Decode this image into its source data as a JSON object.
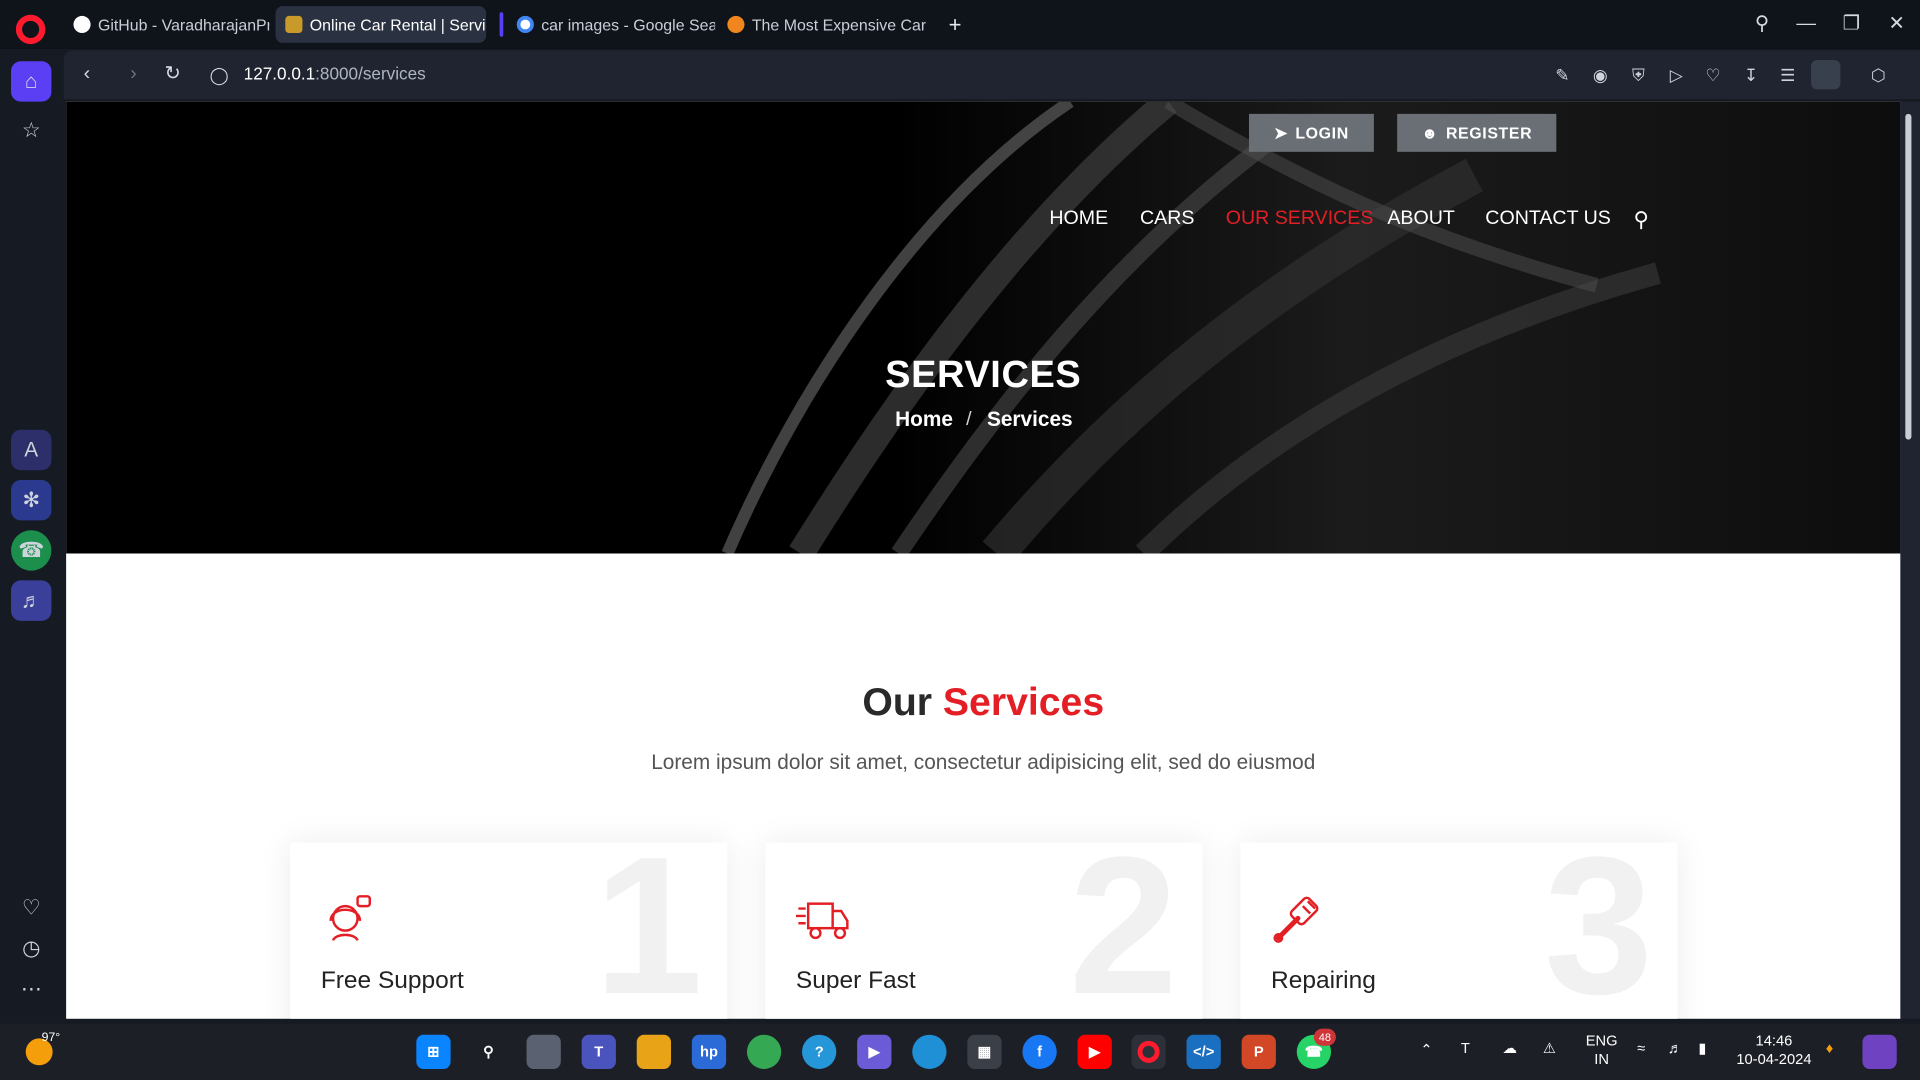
{
  "browser": {
    "tabs": [
      {
        "title": "GitHub - VaradharajanProj"
      },
      {
        "title": "Online Car Rental | Service"
      },
      {
        "title": "car images - Google Searc"
      },
      {
        "title": "The Most Expensive Car In"
      }
    ],
    "url_host": "127.0.0.1",
    "url_path": ":8000/services"
  },
  "site": {
    "login_label": "LOGIN",
    "register_label": "REGISTER",
    "nav": [
      "HOME",
      "CARS",
      "OUR SERVICES",
      "ABOUT",
      "CONTACT US"
    ],
    "active_nav": "OUR SERVICES",
    "hero_title": "SERVICES",
    "breadcrumb": {
      "home": "Home",
      "separator": "/",
      "current": "Services"
    },
    "section_title_dark": "Our",
    "section_title_red": "Services",
    "section_subtitle": "Lorem ipsum dolor sit amet, consectetur adipisicing elit, sed do eiusmod",
    "cards": [
      {
        "number": "1",
        "title": "Free Support",
        "icon": "support-agent-icon"
      },
      {
        "number": "2",
        "title": "Super Fast",
        "icon": "delivery-truck-icon"
      },
      {
        "number": "3",
        "title": "Repairing",
        "icon": "wrench-icon"
      }
    ]
  },
  "taskbar": {
    "weather": "97°",
    "whatsapp_badge": "48",
    "language": "ENG",
    "region": "IN",
    "time": "14:46",
    "date": "10-04-2024"
  },
  "colors": {
    "accent": "#e31e24",
    "opera_accent": "#5b3ff5"
  }
}
